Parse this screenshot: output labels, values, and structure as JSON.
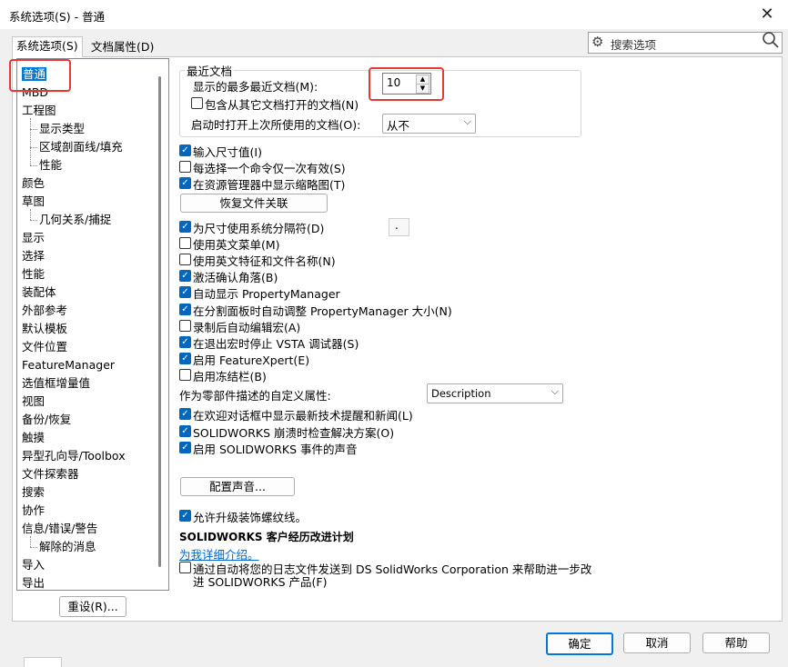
{
  "window": {
    "title": "系统选项(S) - 普通",
    "close_icon": "close-icon"
  },
  "tabs": [
    {
      "label": "系统选项(S)"
    },
    {
      "label": "文档属性(D)"
    }
  ],
  "search": {
    "placeholder": "搜索选项"
  },
  "tree": [
    {
      "label": "普通",
      "level": 0,
      "selected": true
    },
    {
      "label": "MBD",
      "level": 0
    },
    {
      "label": "工程图",
      "level": 0
    },
    {
      "label": "显示类型",
      "level": 1
    },
    {
      "label": "区域剖面线/填充",
      "level": 1
    },
    {
      "label": "性能",
      "level": 1
    },
    {
      "label": "颜色",
      "level": 0
    },
    {
      "label": "草图",
      "level": 0
    },
    {
      "label": "几何关系/捕捉",
      "level": 1
    },
    {
      "label": "显示",
      "level": 0
    },
    {
      "label": "选择",
      "level": 0
    },
    {
      "label": "性能",
      "level": 0
    },
    {
      "label": "装配体",
      "level": 0
    },
    {
      "label": "外部参考",
      "level": 0
    },
    {
      "label": "默认模板",
      "level": 0
    },
    {
      "label": "文件位置",
      "level": 0
    },
    {
      "label": "FeatureManager",
      "level": 0
    },
    {
      "label": "选值框增量值",
      "level": 0
    },
    {
      "label": "视图",
      "level": 0
    },
    {
      "label": "备份/恢复",
      "level": 0
    },
    {
      "label": "触摸",
      "level": 0
    },
    {
      "label": "异型孔向导/Toolbox",
      "level": 0
    },
    {
      "label": "文件探索器",
      "level": 0
    },
    {
      "label": "搜索",
      "level": 0
    },
    {
      "label": "协作",
      "level": 0
    },
    {
      "label": "信息/错误/警告",
      "level": 0
    },
    {
      "label": "解除的消息",
      "level": 1
    },
    {
      "label": "导入",
      "level": 0
    },
    {
      "label": "导出",
      "level": 0
    }
  ],
  "recent": {
    "legend": "最近文档",
    "max_label": "显示的最多最近文档(M):",
    "max_value": "10",
    "include_label": "包含从其它文档打开的文档(N)",
    "include_checked": false,
    "open_last_label": "启动时打开上次所使用的文档(O):",
    "open_last_value": "从不"
  },
  "options": [
    {
      "label": "输入尺寸值(I)",
      "checked": true
    },
    {
      "label": "每选择一个命令仅一次有效(S)",
      "checked": false
    },
    {
      "label": "在资源管理器中显示缩略图(T)",
      "checked": true
    }
  ],
  "restore_button": "恢复文件关联",
  "options2": [
    {
      "label": "为尺寸使用系统分隔符(D)",
      "checked": true
    },
    {
      "label": "使用英文菜单(M)",
      "checked": false
    },
    {
      "label": "使用英文特征和文件名称(N)",
      "checked": false
    },
    {
      "label": "激活确认角落(B)",
      "checked": true
    },
    {
      "label": "自动显示 PropertyManager",
      "checked": true
    },
    {
      "label": "在分割面板时自动调整 PropertyManager 大小(N)",
      "checked": true
    },
    {
      "label": "录制后自动编辑宏(A)",
      "checked": false
    },
    {
      "label": "在退出宏时停止 VSTA 调试器(S)",
      "checked": true
    },
    {
      "label": "启用 FeatureXpert(E)",
      "checked": true
    },
    {
      "label": "启用冻结栏(B)",
      "checked": false
    }
  ],
  "separator_value": ".",
  "custom_prop": {
    "label": "作为零部件描述的自定义属性:",
    "value": "Description"
  },
  "options3": [
    {
      "label": "在欢迎对话框中显示最新技术提醒和新闻(L)",
      "checked": true
    },
    {
      "label": "SOLIDWORKS 崩溃时检查解决方案(O)",
      "checked": true
    },
    {
      "label": "启用 SOLIDWORKS 事件的声音",
      "checked": true
    }
  ],
  "sound_button": "配置声音...",
  "thread_option": {
    "label": "允许升级装饰螺纹线。",
    "checked": true
  },
  "ceip": {
    "title": "SOLIDWORKS 客户经历改进计划",
    "link": "为我详细介绍。",
    "label_line1": "通过自动将您的日志文件发送到 DS SolidWorks Corporation 来帮助进一步改",
    "label_line2": "进 SOLIDWORKS 产品(F)",
    "checked": false
  },
  "reset_button": "重设(R)...",
  "footer": {
    "ok": "确定",
    "cancel": "取消",
    "help": "帮助"
  },
  "colors": {
    "accent": "#0067c0",
    "highlight": "#e53935",
    "link": "#0066cc"
  }
}
